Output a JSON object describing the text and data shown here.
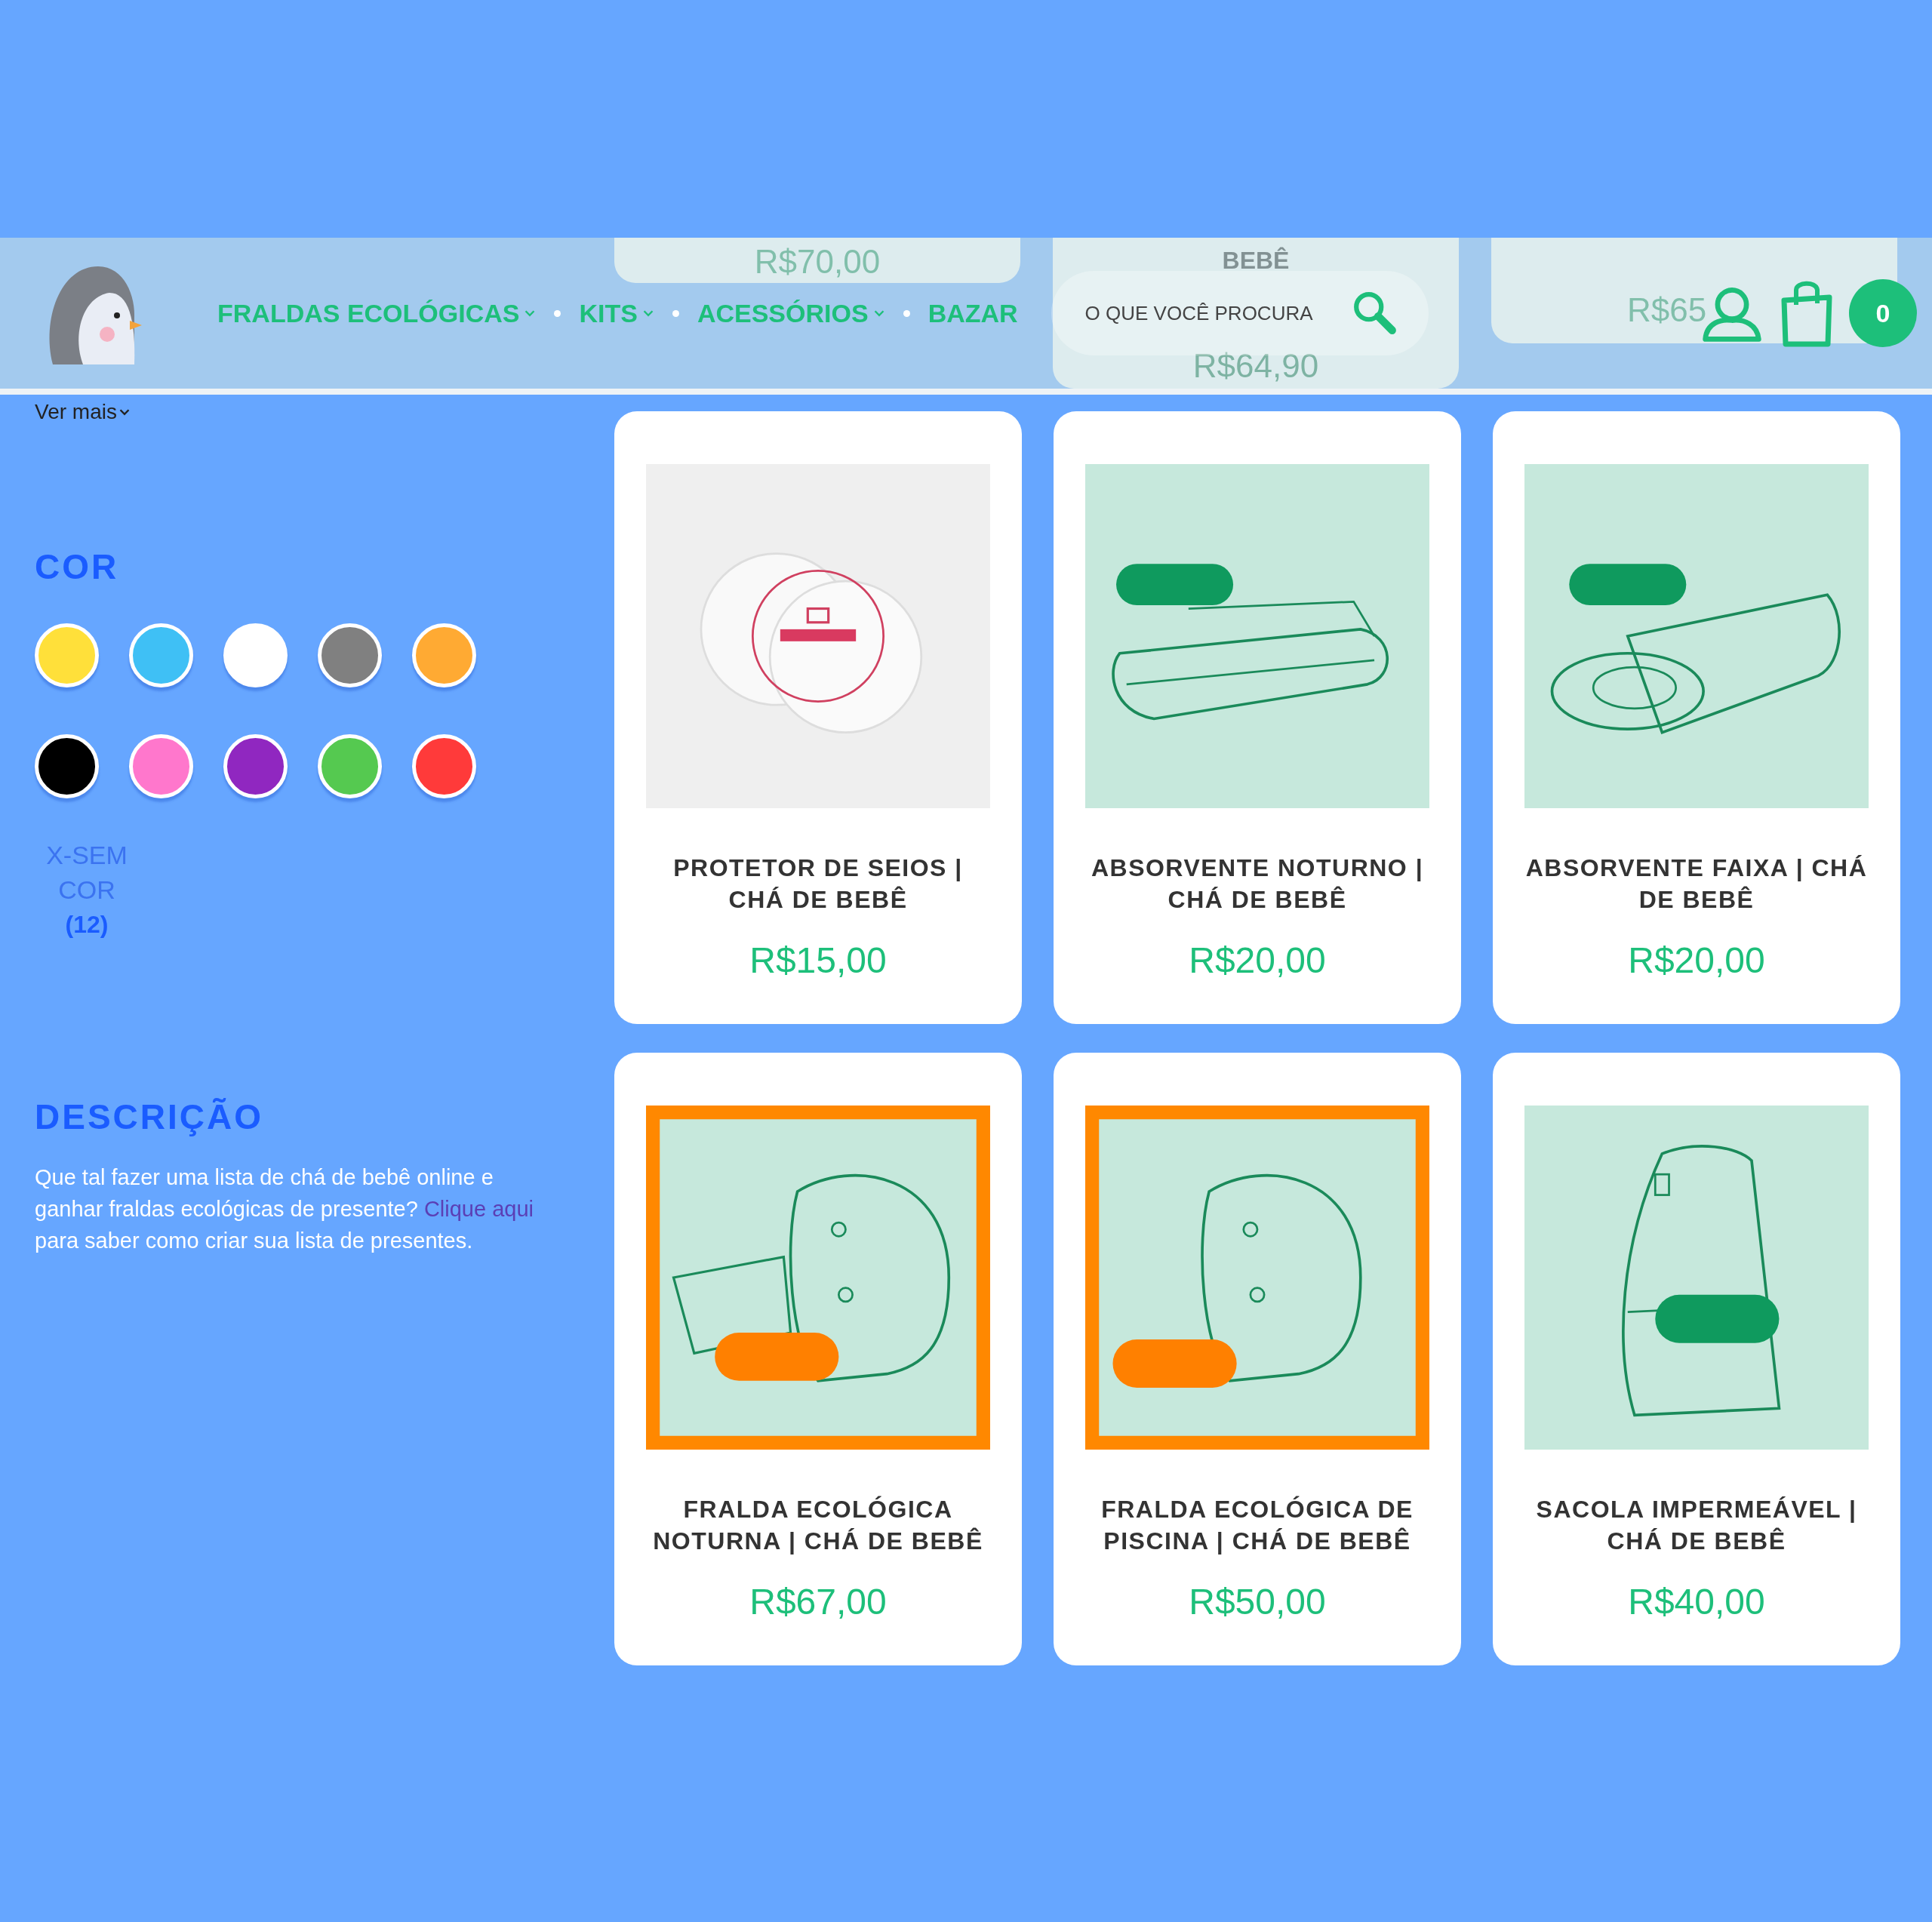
{
  "behind_header": [
    {
      "texts": [
        "R$70,00"
      ]
    },
    {
      "texts": [
        "BEBÊ",
        "R$64,90"
      ]
    },
    {
      "texts": [
        "R$65"
      ]
    }
  ],
  "header": {
    "nav": [
      {
        "label": "FRALDAS ECOLÓGICAS",
        "dropdown": true
      },
      {
        "label": "KITS",
        "dropdown": true
      },
      {
        "label": "ACESSÓRIOS",
        "dropdown": true
      },
      {
        "label": "BAZAR",
        "dropdown": false
      }
    ],
    "search": {
      "placeholder": "O QUE VOCÊ PROCURA"
    },
    "cart_count": "0"
  },
  "filters": {
    "more_link": "Ver mais",
    "color_heading": "COR",
    "colors": [
      {
        "color": "#ffe03a"
      },
      {
        "color": "#3fc0f5"
      },
      {
        "color": "#ffffff"
      },
      {
        "color": "#808080"
      },
      {
        "color": "#ffaa33"
      },
      {
        "color": "#000000"
      },
      {
        "color": "#ff77cc"
      },
      {
        "color": "#9027c0"
      },
      {
        "color": "#55c950"
      },
      {
        "color": "#ff3a3a"
      }
    ],
    "no_color": {
      "label": "X-SEM COR",
      "count": "(12)"
    }
  },
  "description": {
    "heading": "DESCRIÇÃO",
    "text": "Que tal fazer uma lista de chá de bebê online e ganhar fraldas ecológicas de presente?",
    "link": "Clique aqui",
    "text_after": "para saber como criar sua lista de presentes."
  },
  "products": [
    {
      "name": "PROTETOR DE SEIOS | CHÁ DE BEBÊ",
      "price": "R$15,00"
    },
    {
      "name": "ABSORVENTE NOTURNO | CHÁ DE BEBÊ",
      "price": "R$20,00"
    },
    {
      "name": "ABSORVENTE FAIXA | CHÁ DE BEBÊ",
      "price": "R$20,00"
    },
    {
      "name": "FRALDA ECOLÓGICA NOTURNA | CHÁ DE BEBÊ",
      "price": "R$67,00"
    },
    {
      "name": "FRALDA ECOLÓGICA DE PISCINA | CHÁ DE BEBÊ",
      "price": "R$50,00"
    },
    {
      "name": "SACOLA IMPERMEÁVEL | CHÁ DE BEBÊ",
      "price": "R$40,00"
    }
  ]
}
